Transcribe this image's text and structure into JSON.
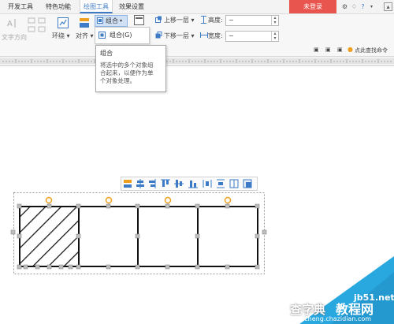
{
  "tabs": [
    "开发工具",
    "特色功能",
    "绘图工具",
    "效果设置"
  ],
  "login_label": "未登录",
  "ribbon": {
    "text_direction": "文字方向",
    "wrap": "环绕",
    "align": "对齐",
    "group": "组合",
    "bring_forward": "上移一层",
    "send_backward": "下移一层",
    "height_label": "高度:",
    "width_label": "宽度:",
    "height_value": "−",
    "width_value": "−",
    "find_command": "点此查找命令"
  },
  "group_menu": {
    "item": "组合(G)"
  },
  "tooltip": {
    "title": "组合",
    "body_line1": "将选中的多个对象组",
    "body_line2": "合起来，以便作为单",
    "body_line3": "个对象处理。"
  },
  "watermark": {
    "site": "jb51.net",
    "brand1": "查字典",
    "brand2": "教程网",
    "domain": "jiaocheng.chazidian.com"
  },
  "colors": {
    "accent": "#3d7bc6",
    "login": "#e8554e",
    "rotate_handle": "#f0a020"
  }
}
